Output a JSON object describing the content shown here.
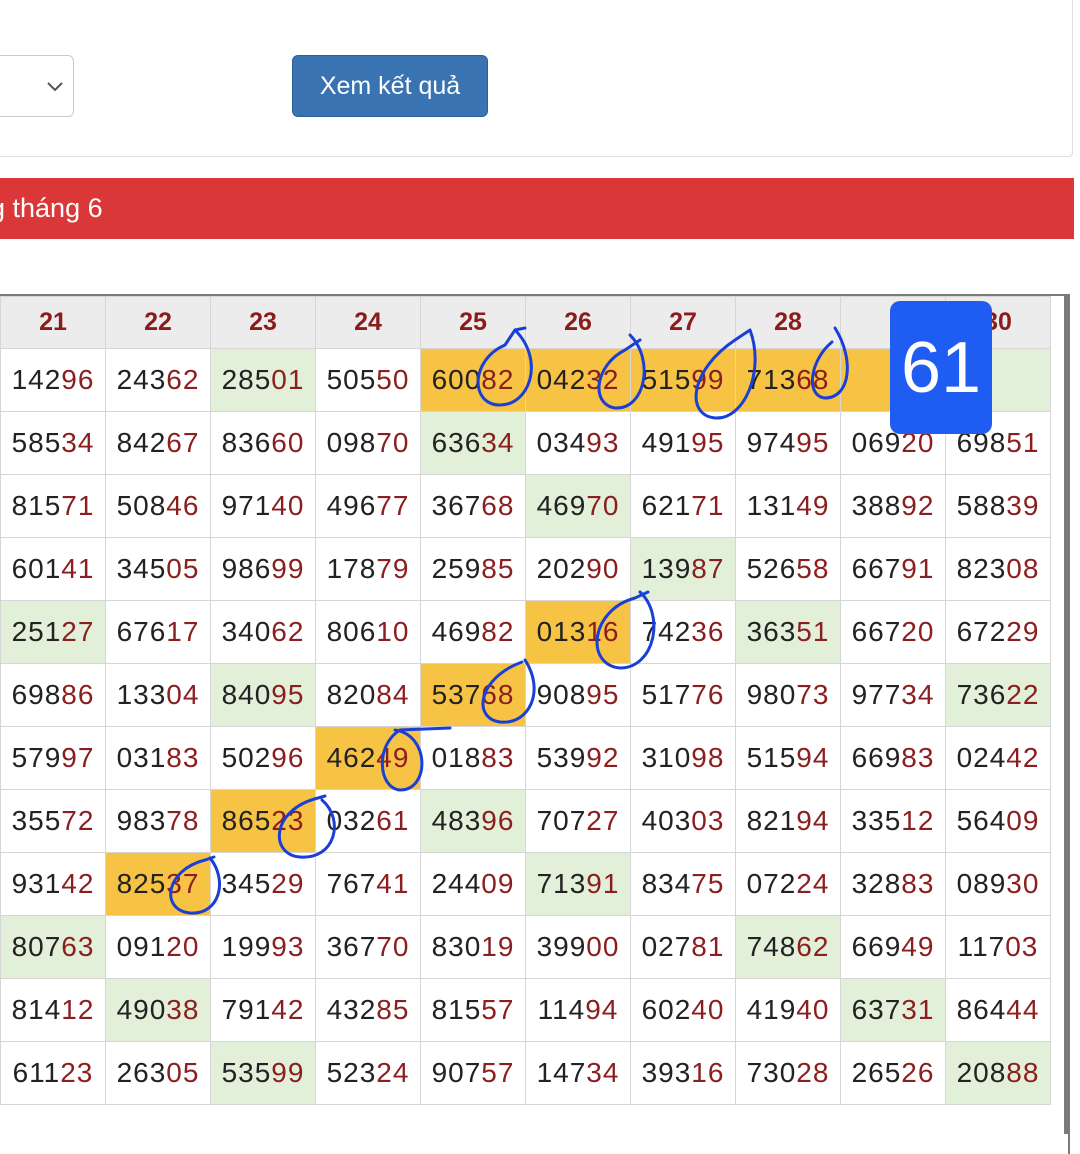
{
  "controls": {
    "view_button_label": "Xem kết quả"
  },
  "banner": {
    "title": "g tháng 6"
  },
  "badge": {
    "value": "61"
  },
  "grid": {
    "columns": [
      "21",
      "22",
      "23",
      "24",
      "25",
      "26",
      "27",
      "28",
      "",
      "30"
    ],
    "rows": [
      [
        [
          "142",
          "96"
        ],
        [
          "243",
          "62"
        ],
        [
          "285",
          "01"
        ],
        [
          "505",
          "50"
        ],
        [
          "600",
          "82"
        ],
        [
          "042",
          "32"
        ],
        [
          "515",
          "99"
        ],
        [
          "713",
          "68"
        ],
        [
          "",
          ""
        ],
        [
          "",
          ""
        ]
      ],
      [
        [
          "585",
          "34"
        ],
        [
          "842",
          "67"
        ],
        [
          "836",
          "60"
        ],
        [
          "098",
          "70"
        ],
        [
          "636",
          "34"
        ],
        [
          "034",
          "93"
        ],
        [
          "491",
          "95"
        ],
        [
          "974",
          "95"
        ],
        [
          "069",
          "20"
        ],
        [
          "698",
          "51"
        ]
      ],
      [
        [
          "815",
          "71"
        ],
        [
          "508",
          "46"
        ],
        [
          "971",
          "40"
        ],
        [
          "496",
          "77"
        ],
        [
          "367",
          "68"
        ],
        [
          "469",
          "70"
        ],
        [
          "621",
          "71"
        ],
        [
          "131",
          "49"
        ],
        [
          "388",
          "92"
        ],
        [
          "588",
          "39"
        ]
      ],
      [
        [
          "601",
          "41"
        ],
        [
          "345",
          "05"
        ],
        [
          "986",
          "99"
        ],
        [
          "178",
          "79"
        ],
        [
          "259",
          "85"
        ],
        [
          "202",
          "90"
        ],
        [
          "139",
          "87"
        ],
        [
          "526",
          "58"
        ],
        [
          "667",
          "91"
        ],
        [
          "823",
          "08"
        ]
      ],
      [
        [
          "251",
          "27"
        ],
        [
          "676",
          "17"
        ],
        [
          "340",
          "62"
        ],
        [
          "806",
          "10"
        ],
        [
          "469",
          "82"
        ],
        [
          "013",
          "16"
        ],
        [
          "742",
          "36"
        ],
        [
          "363",
          "51"
        ],
        [
          "667",
          "20"
        ],
        [
          "672",
          "29"
        ]
      ],
      [
        [
          "698",
          "86"
        ],
        [
          "133",
          "04"
        ],
        [
          "840",
          "95"
        ],
        [
          "820",
          "84"
        ],
        [
          "537",
          "68"
        ],
        [
          "908",
          "95"
        ],
        [
          "517",
          "76"
        ],
        [
          "980",
          "73"
        ],
        [
          "977",
          "34"
        ],
        [
          "736",
          "22"
        ]
      ],
      [
        [
          "579",
          "97"
        ],
        [
          "031",
          "83"
        ],
        [
          "502",
          "96"
        ],
        [
          "462",
          "49"
        ],
        [
          "018",
          "83"
        ],
        [
          "539",
          "92"
        ],
        [
          "310",
          "98"
        ],
        [
          "515",
          "94"
        ],
        [
          "669",
          "83"
        ],
        [
          "024",
          "42"
        ]
      ],
      [
        [
          "355",
          "72"
        ],
        [
          "983",
          "78"
        ],
        [
          "865",
          "23"
        ],
        [
          "032",
          "61"
        ],
        [
          "483",
          "96"
        ],
        [
          "707",
          "27"
        ],
        [
          "403",
          "03"
        ],
        [
          "821",
          "94"
        ],
        [
          "335",
          "12"
        ],
        [
          "564",
          "09"
        ]
      ],
      [
        [
          "931",
          "42"
        ],
        [
          "825",
          "37"
        ],
        [
          "345",
          "29"
        ],
        [
          "767",
          "41"
        ],
        [
          "244",
          "09"
        ],
        [
          "713",
          "91"
        ],
        [
          "834",
          "75"
        ],
        [
          "072",
          "24"
        ],
        [
          "328",
          "83"
        ],
        [
          "089",
          "30"
        ]
      ],
      [
        [
          "807",
          "63"
        ],
        [
          "091",
          "20"
        ],
        [
          "199",
          "93"
        ],
        [
          "367",
          "70"
        ],
        [
          "830",
          "19"
        ],
        [
          "399",
          "00"
        ],
        [
          "027",
          "81"
        ],
        [
          "748",
          "62"
        ],
        [
          "669",
          "49"
        ],
        [
          "117",
          "03"
        ]
      ],
      [
        [
          "814",
          "12"
        ],
        [
          "490",
          "38"
        ],
        [
          "791",
          "42"
        ],
        [
          "432",
          "85"
        ],
        [
          "815",
          "57"
        ],
        [
          "114",
          "94"
        ],
        [
          "602",
          "40"
        ],
        [
          "419",
          "40"
        ],
        [
          "637",
          "31"
        ],
        [
          "864",
          "44"
        ]
      ],
      [
        [
          "611",
          "23"
        ],
        [
          "263",
          "05"
        ],
        [
          "535",
          "99"
        ],
        [
          "523",
          "24"
        ],
        [
          "907",
          "57"
        ],
        [
          "147",
          "34"
        ],
        [
          "393",
          "16"
        ],
        [
          "730",
          "28"
        ],
        [
          "265",
          "26"
        ],
        [
          "208",
          "88"
        ]
      ]
    ],
    "highlights": {
      "orange": [
        [
          0,
          4
        ],
        [
          0,
          5
        ],
        [
          0,
          6
        ],
        [
          0,
          7
        ],
        [
          0,
          8
        ],
        [
          4,
          5
        ],
        [
          5,
          4
        ],
        [
          6,
          3
        ],
        [
          7,
          2
        ],
        [
          8,
          1
        ]
      ],
      "green": [
        [
          0,
          2
        ],
        [
          0,
          9
        ],
        [
          1,
          4
        ],
        [
          2,
          5
        ],
        [
          3,
          6
        ],
        [
          4,
          0
        ],
        [
          4,
          7
        ],
        [
          5,
          2
        ],
        [
          5,
          9
        ],
        [
          7,
          4
        ],
        [
          8,
          5
        ],
        [
          9,
          0
        ],
        [
          9,
          7
        ],
        [
          10,
          1
        ],
        [
          10,
          8
        ],
        [
          11,
          2
        ],
        [
          11,
          9
        ]
      ]
    }
  },
  "colors": {
    "banner": "#da3838",
    "button": "#3a73b2",
    "badge": "#1e5cf2",
    "orange_highlight": "#f7c344",
    "green_highlight": "#e2efd9",
    "tail_digits": "#8b1e1e",
    "annotation_ink": "#1a3fd6"
  }
}
